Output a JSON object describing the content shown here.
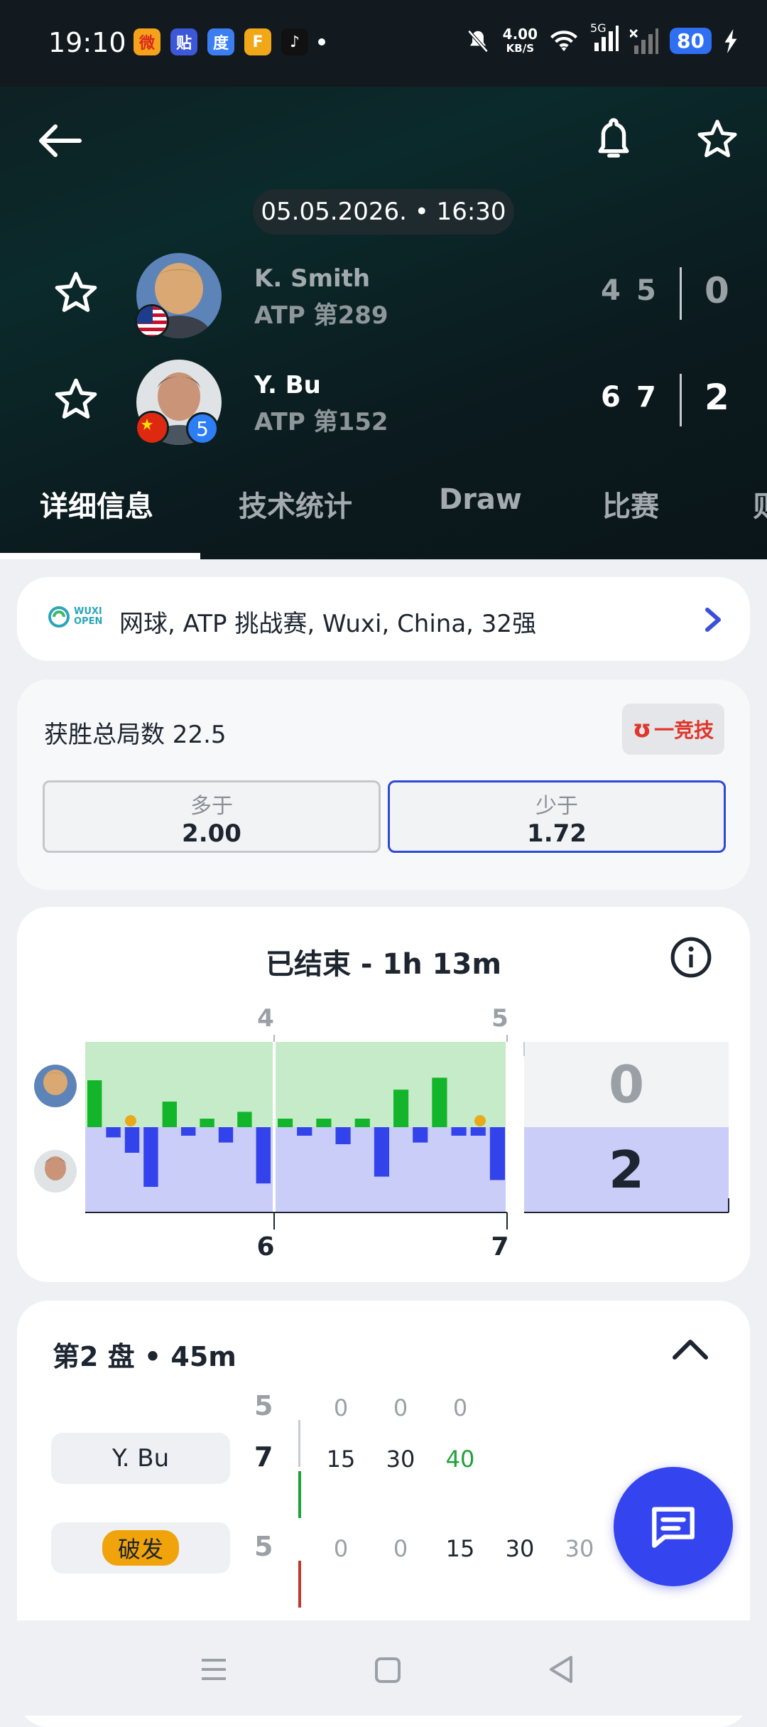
{
  "status_bar": {
    "time": "19:10",
    "apps": [
      {
        "icon": "weibo-icon",
        "glyph": "微",
        "bg": "#f4a21b",
        "fg": "#d9291b"
      },
      {
        "icon": "tieba-icon",
        "glyph": "贴",
        "bg": "#3c57d8",
        "fg": "#ffffff"
      },
      {
        "icon": "baidu-icon",
        "glyph": "度",
        "bg": "#3b7ef2",
        "fg": "#ffffff"
      },
      {
        "icon": "sports-app-icon",
        "glyph": "F",
        "bg": "#f0a818",
        "fg": "#ffffff"
      },
      {
        "icon": "tiktok-icon",
        "glyph": "♪",
        "bg": "#111111",
        "fg": "#ffffff"
      }
    ],
    "speed_value": "4.00",
    "speed_unit": "KB/S",
    "network": "5G",
    "battery": "80"
  },
  "match": {
    "datetime": "05.05.2026. • 16:30",
    "players": [
      {
        "name": "K. Smith",
        "rank": "ATP 第289",
        "sets": [
          "4",
          "5"
        ],
        "total": "0",
        "flag": "usa-flag",
        "seed": "",
        "avatar_bg": "#c49a62"
      },
      {
        "name": "Y. Bu",
        "rank": "ATP 第152",
        "sets": [
          "6",
          "7"
        ],
        "total": "2",
        "flag": "china-flag",
        "seed": "5",
        "avatar_bg": "#8b6c5c"
      }
    ]
  },
  "tabs": [
    "详细信息",
    "技术统计",
    "Draw",
    "比赛",
    "则"
  ],
  "tournament": {
    "logo_line1": "WUXI",
    "logo_line2": "OPEN",
    "text": "网球, ATP 挑战赛, Wuxi, China, 32强"
  },
  "bet": {
    "title": "获胜总局数 22.5",
    "brand": "一竞技",
    "options": [
      {
        "label": "多于",
        "value": "2.00"
      },
      {
        "label": "少于",
        "value": "1.72"
      }
    ]
  },
  "momentum": {
    "title": "已结束 - 1h 13m",
    "top_set_labels": [
      "4",
      "5"
    ],
    "bottom_set_labels": [
      "6",
      "7"
    ],
    "score_top": "0",
    "score_bottom": "2",
    "set1_bars": [
      0.55,
      -0.12,
      -0.3,
      -0.7,
      0.3,
      -0.1,
      0.1,
      -0.18,
      0.18,
      -0.66
    ],
    "set2_bars": [
      0.1,
      -0.1,
      0.1,
      -0.2,
      0.1,
      -0.58,
      0.44,
      -0.18,
      0.58,
      -0.1,
      -0.1,
      -0.62
    ]
  },
  "set_detail": {
    "title": "第2 盘 • 45m",
    "rows": [
      {
        "player": "",
        "games": "5",
        "points": [
          "0",
          "0",
          "0"
        ],
        "last_color": "#9aa0a6"
      },
      {
        "player": "Y. Bu",
        "games": "7",
        "points": [
          "15",
          "30",
          "40"
        ],
        "last_color": "#1fa13a"
      },
      {
        "player": "破发",
        "games": "5",
        "points": [
          "0",
          "0",
          "15",
          "30",
          "30"
        ],
        "last_color": "#9aa0a6"
      }
    ]
  }
}
